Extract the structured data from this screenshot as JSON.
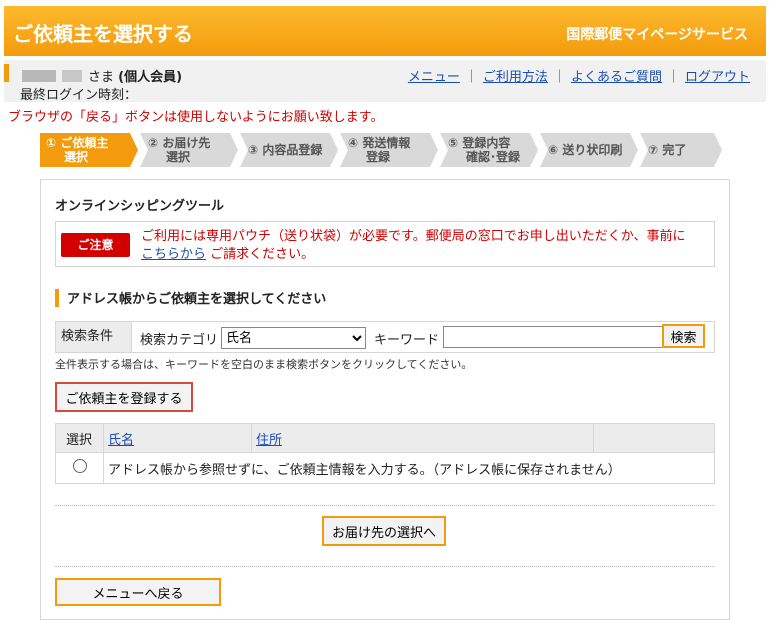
{
  "header": {
    "title": "ご依頼主を選択する",
    "service": "国際郵便マイページサービス"
  },
  "user": {
    "suffix": "さま",
    "member_type": "(個人会員)",
    "last_login_label": "最終ログイン時刻："
  },
  "nav": {
    "menu": "メニュー",
    "usage": "ご利用方法",
    "faq": "よくあるご質問",
    "logout": "ログアウト",
    "separator": "｜"
  },
  "warning": "ブラウザの「戻る」ボタンは使用しないようにお願い致します。",
  "steps": [
    {
      "line1": "① ご依頼主",
      "line2": "選択"
    },
    {
      "line1": "② お届け先",
      "line2": "選択"
    },
    {
      "line1": "③ 内容品登録",
      "line2": ""
    },
    {
      "line1": "④ 発送情報",
      "line2": "登録"
    },
    {
      "line1": "⑤ 登録内容",
      "line2": "確認･登録"
    },
    {
      "line1": "⑥ 送り状印刷",
      "line2": ""
    },
    {
      "line1": "⑦ 完了",
      "line2": ""
    }
  ],
  "tool_title": "オンラインシッピングツール",
  "notice": {
    "badge": "ご注意",
    "line1": "ご利用には専用パウチ（送り状袋）が必要です。郵便局の窓口でお申し出いただくか、事前に",
    "link": "こちらから",
    "line2_rest": " ご請求ください。"
  },
  "section_title": "アドレス帳からご依頼主を選択してください",
  "search": {
    "label": "検索条件",
    "category_label": "検索カテゴリ",
    "category_value": "氏名",
    "keyword_label": "キーワード",
    "keyword_value": "",
    "button": "検索"
  },
  "hint": "全件表示する場合は、キーワードを空白のまま検索ボタンをクリックしてください。",
  "register_button": "ご依頼主を登録する",
  "table": {
    "headers": [
      "選択",
      "氏名",
      "住所",
      ""
    ],
    "row_text": "アドレス帳から参照せずに、ご依頼主情報を入力する。（アドレス帳に保存されません）"
  },
  "next_button": "お届け先の選択へ",
  "back_button": "メニューへ戻る",
  "colors": {
    "accent": "#f39b0c",
    "warning": "#d00000",
    "link": "#1a4db3"
  }
}
